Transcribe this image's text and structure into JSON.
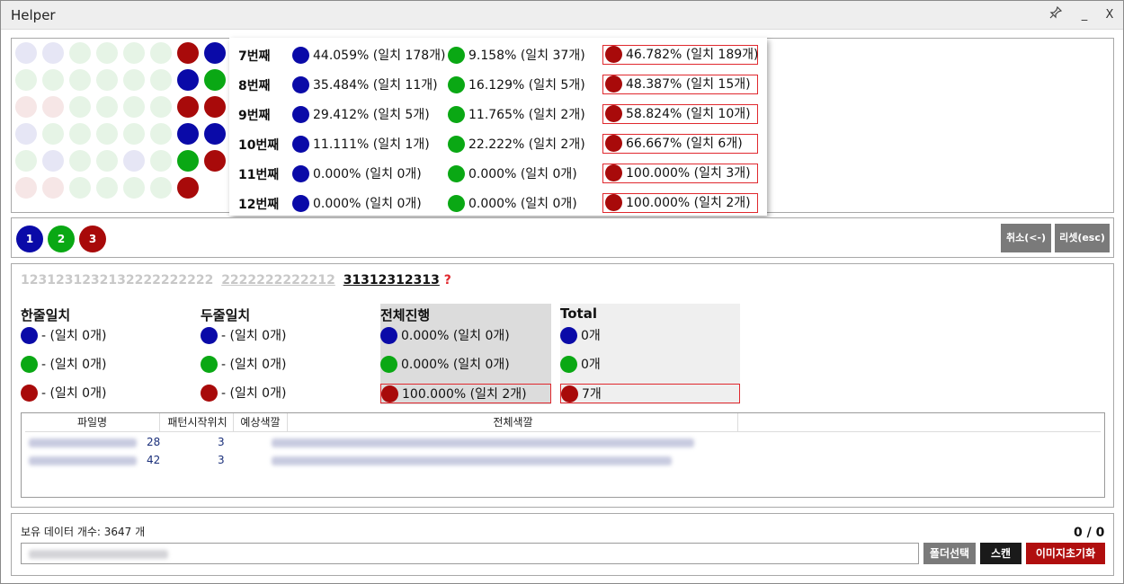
{
  "window": {
    "title": "Helper",
    "pin_icon": "pin-icon",
    "minimize_label": "_",
    "close_label": "X"
  },
  "colors": {
    "blue": "#0a0aa8",
    "green": "#0aa814",
    "red": "#a80a0a",
    "light_blue": "#e6e6f5",
    "light_green": "#e6f4e6",
    "light_red": "#f6e6e6"
  },
  "bead_grid": [
    [
      "light_blue",
      "light_blue",
      "light_green",
      "light_green",
      "light_green",
      "light_green",
      "red",
      "blue"
    ],
    [
      "light_green",
      "light_green",
      "light_green",
      "light_green",
      "light_green",
      "light_green",
      "blue",
      "green"
    ],
    [
      "light_red",
      "light_red",
      "light_green",
      "light_green",
      "light_green",
      "light_green",
      "red",
      "red"
    ],
    [
      "light_blue",
      "light_green",
      "light_green",
      "light_green",
      "light_green",
      "light_green",
      "blue",
      "blue"
    ],
    [
      "light_green",
      "light_blue",
      "light_green",
      "light_green",
      "light_blue",
      "light_green",
      "green",
      "red"
    ],
    [
      "light_red",
      "light_red",
      "light_green",
      "light_green",
      "light_green",
      "light_green",
      "red",
      ""
    ]
  ],
  "popup_rows": [
    {
      "label": "7번째",
      "blue": "44.059% (일치 178개)",
      "green": "9.158% (일치 37개)",
      "red": "46.782% (일치 189개)"
    },
    {
      "label": "8번째",
      "blue": "35.484% (일치 11개)",
      "green": "16.129% (일치 5개)",
      "red": "48.387% (일치 15개)"
    },
    {
      "label": "9번째",
      "blue": "29.412% (일치 5개)",
      "green": "11.765% (일치 2개)",
      "red": "58.824% (일치 10개)"
    },
    {
      "label": "10번째",
      "blue": "11.111% (일치 1개)",
      "green": "22.222% (일치 2개)",
      "red": "66.667% (일치 6개)"
    },
    {
      "label": "11번째",
      "blue": "0.000% (일치 0개)",
      "green": "0.000% (일치 0개)",
      "red": "100.000% (일치 3개)"
    },
    {
      "label": "12번째",
      "blue": "0.000% (일치 0개)",
      "green": "0.000% (일치 0개)",
      "red": "100.000% (일치 2개)"
    }
  ],
  "pick_buttons": {
    "one": "1",
    "two": "2",
    "three": "3"
  },
  "actions": {
    "undo": "취소(<-)",
    "reset": "리셋(esc)"
  },
  "sequence": {
    "part1": "1231231232132222222222",
    "part2": "2222222222212",
    "part3": "31312312313",
    "part4": "?"
  },
  "stats": {
    "single": {
      "title": "한줄일치",
      "blue": "- (일치 0개)",
      "green": "- (일치 0개)",
      "red": "- (일치 0개)"
    },
    "double": {
      "title": "두줄일치",
      "blue": "- (일치 0개)",
      "green": "- (일치 0개)",
      "red": "- (일치 0개)"
    },
    "overall": {
      "title": "전체진행",
      "blue": "0.000% (일치 0개)",
      "green": "0.000% (일치 0개)",
      "red": "100.000% (일치 2개)"
    },
    "total": {
      "title": "Total",
      "blue": "0개",
      "green": "0개",
      "red": "7개"
    }
  },
  "table": {
    "columns": [
      "파일명",
      "패턴시작위치",
      "예상색깔",
      "전체색깔"
    ],
    "rows": [
      {
        "start": "28",
        "predicted": "3"
      },
      {
        "start": "42",
        "predicted": "3"
      }
    ]
  },
  "footer": {
    "data_count_label": "보유 데이터 개수:  3647 개",
    "progress": "0 / 0",
    "folder_button": "폴더선택",
    "scan_button": "스캔",
    "reset_images_button": "이미지초기화"
  }
}
